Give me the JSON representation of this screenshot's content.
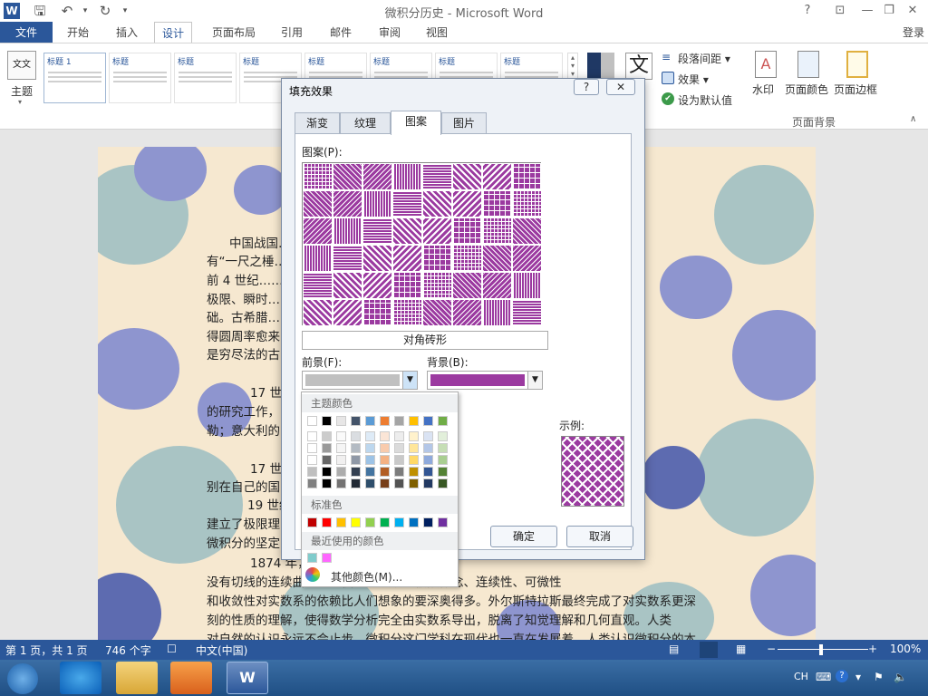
{
  "window": {
    "title": "微积分历史 - Microsoft Word",
    "login": "登录"
  },
  "qat": {
    "save_icon": "save-icon",
    "undo_icon": "undo-icon",
    "redo_icon": "redo-icon"
  },
  "ribbon_tabs": [
    "文件",
    "开始",
    "插入",
    "设计",
    "页面布局",
    "引用",
    "邮件",
    "审阅",
    "视图"
  ],
  "ribbon": {
    "theme_label": "主题",
    "gallery_labels": [
      "标题 1",
      "标题",
      "标题",
      "标题",
      "标题",
      "标题",
      "标题",
      "标题"
    ],
    "spacing": "段落间距 ▾",
    "effects": "效果 ▾",
    "set_default": "设为默认值",
    "watermark": "水印",
    "page_color": "页面颜色",
    "page_border": "页面边框",
    "group_label": "页面背景",
    "font_glyph": "文"
  },
  "document": {
    "lines": [
      "中国战国……篇”中，记",
      "有“一尺之棰……思想；公元",
      "前 4 世纪……的定义和",
      "极限、瞬时……微分学的基",
      "础。古希腊……周长，而求",
      "得圆周率愈来……其面积，这",
      "是穷尽法的古",
      "17 世纪……做作了大量",
      "的研究工作，……德国的开普",
      "勒；意大利的……贡献。",
      "17 世纪……莱布尼茨分",
      "别在自己的国……工作。",
      "19 世纪……认真研究，",
      "建立了极限理……理论成为了",
      "微积分的坚定",
      "1874 年，……构造了一条",
      "没有切线的连续曲……它使人们认识到极限概念、连续性、可微性",
      "和收敛性对实数系的依赖比人们想象的要深奥得多。外尔斯特拉斯最终完成了对实数系更深",
      "刻的性质的理解，使得数学分析完全由实数系导出，脱离了知觉理解和几何直观。人类",
      "对自然的认识永远不会止步，微积分这门学科在现代也一直在发展着。人类认识微积分的本"
    ]
  },
  "dialog": {
    "title": "填充效果",
    "help": "?",
    "close": "✕",
    "tabs": [
      "渐变",
      "纹理",
      "图案",
      "图片"
    ],
    "active_tab": "图案",
    "pattern_label": "图案(P):",
    "selected_pattern": "对角砖形",
    "foreground_label": "前景(F):",
    "background_label": "背景(B):",
    "sample_label": "示例:",
    "ok": "确定",
    "cancel": "取消",
    "foreground_color": "#c0c0c0",
    "background_color": "#9b3aa0"
  },
  "color_menu": {
    "theme_colors": "主题颜色",
    "standard_colors": "标准色",
    "recent_colors": "最近使用的颜色",
    "more_colors": "其他颜色(M)...",
    "theme_top": [
      "#ffffff",
      "#000000",
      "#e7e6e6",
      "#44546a",
      "#5b9bd5",
      "#ed7d31",
      "#a5a5a5",
      "#ffc000",
      "#4472c4",
      "#70ad47"
    ],
    "standard": [
      "#c00000",
      "#ff0000",
      "#ffc000",
      "#ffff00",
      "#92d050",
      "#00b050",
      "#00b0f0",
      "#0070c0",
      "#002060",
      "#7030a0"
    ],
    "recent": [
      "#80cccc",
      "#ff66ff"
    ]
  },
  "statusbar": {
    "page": "第 1 页，共 1 页",
    "words": "746 个字",
    "lang": "中文(中国)",
    "zoom": "100%"
  },
  "taskbar": {
    "ime": "CH"
  }
}
